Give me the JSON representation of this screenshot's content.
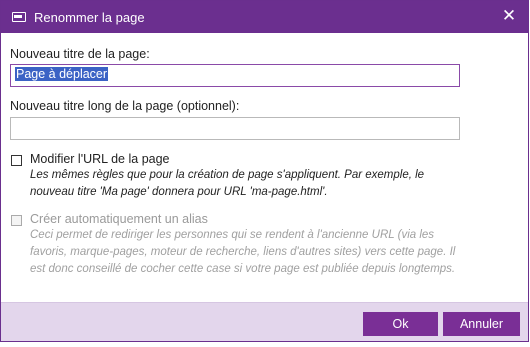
{
  "dialog": {
    "title": "Renommer la page",
    "close_glyph": "✕"
  },
  "fields": {
    "title_label": "Nouveau titre de la page:",
    "title_value": "Page à déplacer",
    "long_title_label": "Nouveau titre long de la page (optionnel):",
    "long_title_value": ""
  },
  "options": {
    "modify_url": {
      "label": "Modifier l'URL de la page",
      "checked": false,
      "enabled": true,
      "help": "Les mêmes règles que pour la création de page s'appliquent. Par exemple, le nouveau titre 'Ma page' donnera pour URL 'ma-page.html'."
    },
    "create_alias": {
      "label": "Créer automatiquement un alias",
      "checked": false,
      "enabled": false,
      "help": "Ceci permet de rediriger les personnes qui se rendent à l'ancienne URL (via les favoris, marque-pages, moteur de recherche, liens d'autres sites) vers cette page. Il est donc conseillé de cocher cette case si votre page est publiée depuis longtemps."
    }
  },
  "buttons": {
    "ok": "Ok",
    "cancel": "Annuler"
  },
  "colors": {
    "titlebar": "#6b2f8f",
    "button": "#7a2f96",
    "footer": "#e3d6ec",
    "selection": "#3b62c5"
  },
  "icons": {
    "window": "window-icon",
    "close": "close-icon"
  }
}
